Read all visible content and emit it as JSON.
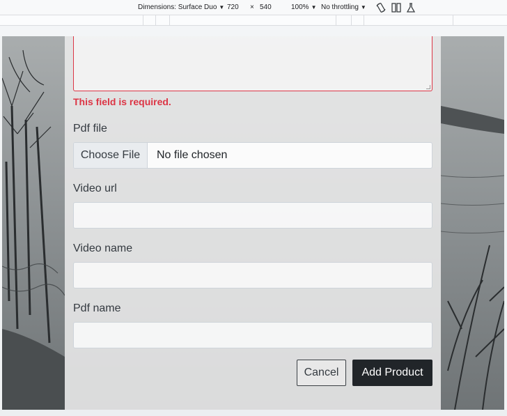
{
  "devtools": {
    "dimensions_label": "Dimensions: Surface Duo",
    "width": "720",
    "times": "×",
    "height": "540",
    "zoom": "100%",
    "throttling": "No throttling",
    "caret": "▼",
    "icons": [
      "rotate-icon",
      "dual-screen-icon",
      "sensors-flask-icon"
    ]
  },
  "form": {
    "error_message": "This field is required.",
    "pdf_file_label": "Pdf file",
    "choose_file_label": "Choose File",
    "no_file_text": "No file chosen",
    "video_url_label": "Video url",
    "video_url_value": "",
    "video_name_label": "Video name",
    "video_name_value": "",
    "pdf_name_label": "Pdf name",
    "pdf_name_value": "",
    "cancel_label": "Cancel",
    "add_product_label": "Add Product"
  },
  "colors": {
    "error": "#dc3545",
    "primary_button": "#212529",
    "panel": "#ececec"
  }
}
